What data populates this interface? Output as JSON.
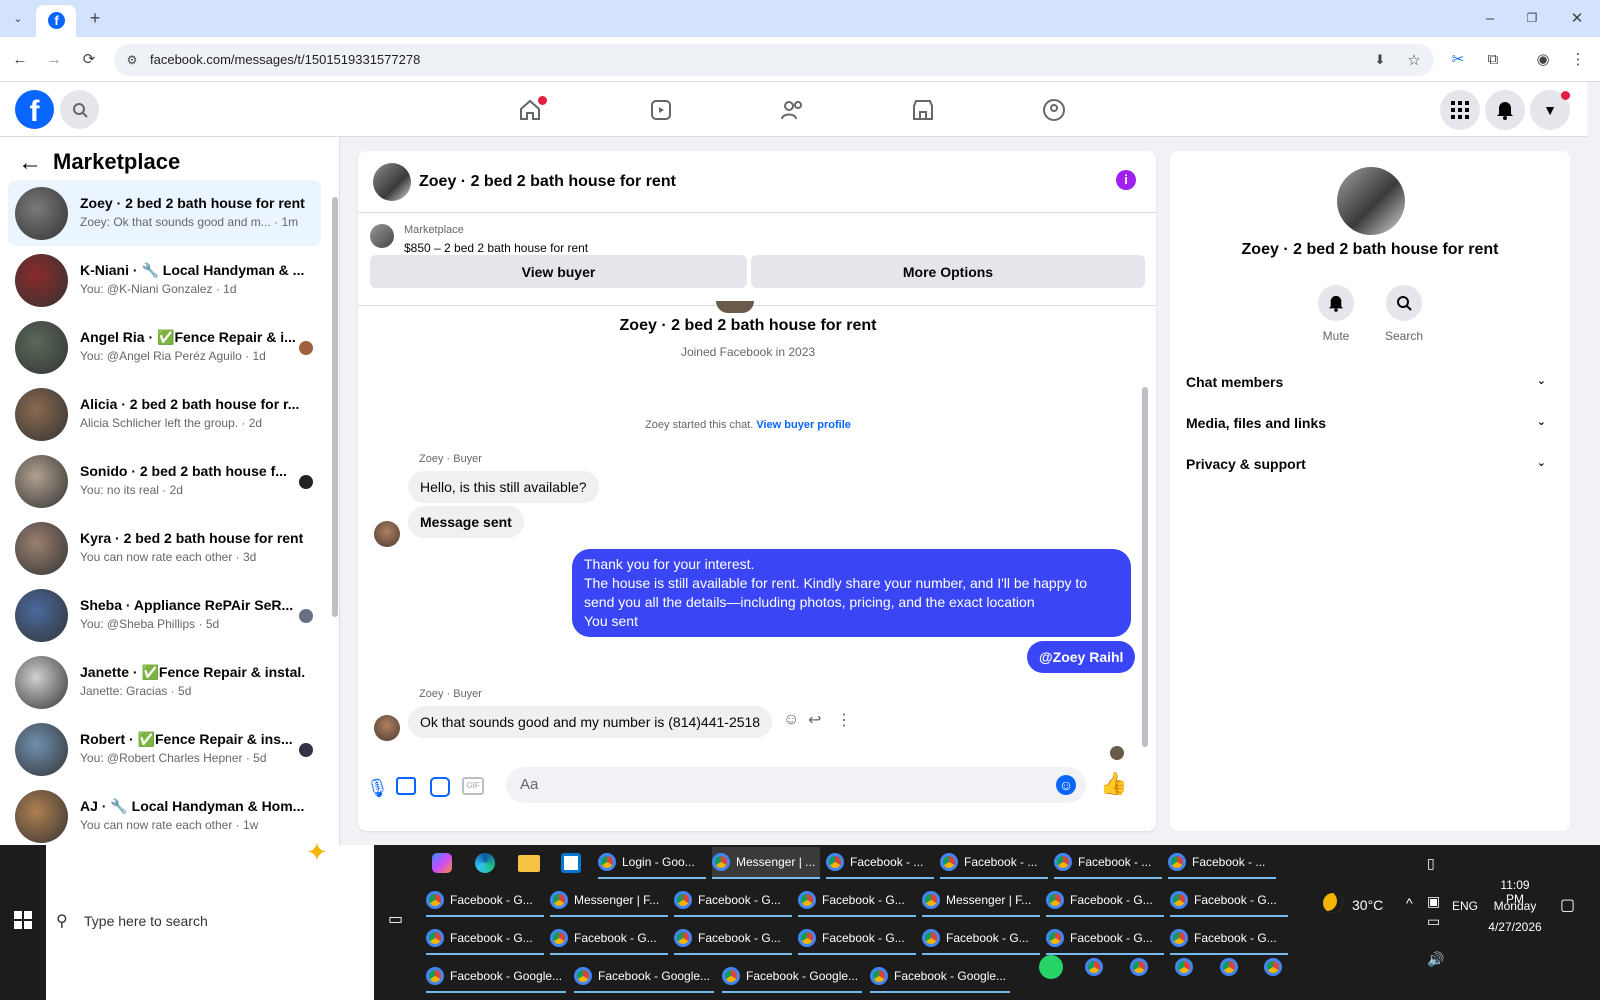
{
  "browser": {
    "url": "facebook.com/messages/t/1501519331577278",
    "new_tab_symbol": "+",
    "back_symbol": "←",
    "forward_symbol": "→",
    "reload_symbol": "⟳"
  },
  "left_panel": {
    "title": "Marketplace",
    "back_symbol": "←",
    "conversations": [
      {
        "name": "Zoey · 2 bed 2 bath house for rent",
        "preview": "Zoey: Ok that sounds good and m...",
        "time": " · 1m",
        "active": true
      },
      {
        "name": "K-Niani · 🔧 Local Handyman & ...",
        "preview": "You: @K-Niani Gonzalez",
        "time": " · 1d"
      },
      {
        "name": "Angel Ria · ✅Fence Repair & i...",
        "preview": "You: @Angel Ria Peréz Aguilo",
        "time": " · 1d"
      },
      {
        "name": "Alicia · 2 bed 2 bath house for r...",
        "preview": "Alicia Schlicher left the group.",
        "time": " · 2d"
      },
      {
        "name": "Sonido · 2 bed 2 bath house f...",
        "preview": "You: no its real",
        "time": " · 2d"
      },
      {
        "name": "Kyra · 2 bed 2 bath house for rent",
        "preview": "You can now rate each other",
        "time": " · 3d"
      },
      {
        "name": "Sheba · Appliance RePAir SeR...",
        "preview": "You: @Sheba Phillips",
        "time": " · 5d"
      },
      {
        "name": "Janette · ✅Fence Repair & instal...",
        "preview": "Janette: Gracias",
        "time": " · 5d"
      },
      {
        "name": "Robert · ✅Fence Repair & ins...",
        "preview": "You: @Robert Charles Hepner",
        "time": " · 5d"
      },
      {
        "name": "AJ · 🔧 Local Handyman & Hom...",
        "preview": "You can now rate each other",
        "time": " · 1w"
      }
    ]
  },
  "chat": {
    "title": "Zoey · 2 bed 2 bath house for rent",
    "listing_label": "Marketplace",
    "listing_title": "$850 – 2 bed 2 bath house for rent",
    "view_buyer": "View buyer",
    "more_options": "More Options",
    "profile_name": "Zoey · 2 bed 2 bath house for rent",
    "joined": "Joined Facebook in 2023",
    "started": "Zoey started this chat.",
    "view_buyer_profile": "View buyer profile",
    "sender_label": "Zoey · Buyer",
    "msg1": "Hello, is this still available?",
    "msg2": "Message sent",
    "out_line1": "Thank you for your interest.",
    "out_line2": "The house is still available for rent. Kindly share your number, and I'll be happy to",
    "out_line3": "send you all the details—including photos, pricing, and the exact location",
    "out_line4": "You sent",
    "mention": "@Zoey Raihl",
    "sender_label2": "Zoey · Buyer",
    "msg3": "Ok that sounds good and my number is (814)441-2518",
    "composer_placeholder": "Aa",
    "gif_label": "GIF"
  },
  "right_panel": {
    "name": "Zoey · 2 bed 2 bath house for rent",
    "mute": "Mute",
    "search": "Search",
    "sections": [
      "Chat members",
      "Media, files and links",
      "Privacy & support"
    ]
  },
  "taskbar": {
    "search_placeholder": "Type here to search",
    "row1": [
      "Login - Goo...",
      "Messenger | ...",
      "Facebook - ...",
      "Facebook - ...",
      "Facebook - ...",
      "Facebook - ..."
    ],
    "row2": [
      "Facebook - G...",
      "Messenger | F...",
      "Facebook - G...",
      "Facebook - G...",
      "Messenger | F...",
      "Facebook - G...",
      "Facebook - G..."
    ],
    "row3": [
      "Facebook - G...",
      "Facebook - G...",
      "Facebook - G...",
      "Facebook - G...",
      "Facebook - G...",
      "Facebook - G...",
      "Facebook - G..."
    ],
    "row4": [
      "Facebook - Google...",
      "Facebook - Google...",
      "Facebook - Google...",
      "Facebook - Google..."
    ],
    "weather": "30°C",
    "lang": "ENG",
    "time": "11:09 PM",
    "day": "Monday",
    "date": "4/27/2026"
  },
  "colors": {
    "fb_blue": "#0866ff",
    "bubble_blue": "#3a46f5",
    "notification_red": "#e41e3f",
    "info_purple": "#a020f0"
  }
}
